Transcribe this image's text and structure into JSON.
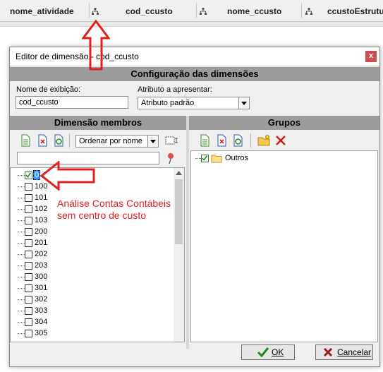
{
  "grid_header": {
    "columns": [
      "nome_atividade",
      "cod_ccusto",
      "nome_ccusto",
      "ccustoEstrutu"
    ]
  },
  "dialog": {
    "title": "Editor de dimensão -  cod_ccusto",
    "close_label": "x",
    "config_header": "Configuração das dimensões",
    "display_name_label": "Nome de exibição:",
    "display_name_value": "cod_ccusto",
    "attribute_label": "Atributo a apresentar:",
    "attribute_value": "Atributo padrão",
    "members_header": "Dimensão membros",
    "groups_header": "Grupos",
    "sort_value": "Ordenar por nome",
    "members": [
      "0",
      "100",
      "101",
      "102",
      "103",
      "200",
      "201",
      "202",
      "203",
      "300",
      "301",
      "302",
      "303",
      "304",
      "305"
    ],
    "groups": [
      "Outros"
    ],
    "ok_label": "OK",
    "cancel_label": "Cancelar"
  },
  "annotation": {
    "line1": "Análise Contas Contábeis",
    "line2": "sem centro de custo",
    "color": "#e02020"
  }
}
